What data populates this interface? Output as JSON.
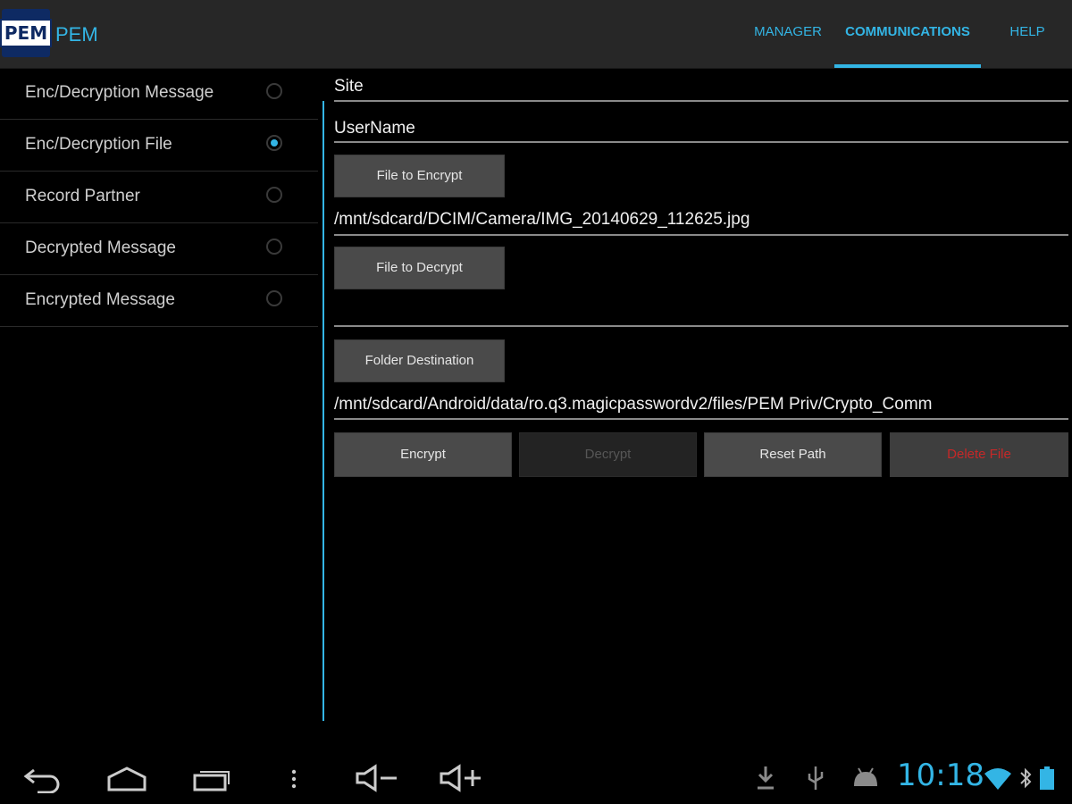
{
  "app": {
    "title": "PEM",
    "logo_text": "PEM"
  },
  "tabs": [
    {
      "label": "MANAGER",
      "active": false
    },
    {
      "label": "COMMUNICATIONS",
      "active": true
    },
    {
      "label": "HELP",
      "active": false
    }
  ],
  "sidebar": {
    "items": [
      {
        "label": "Enc/Decryption Message",
        "selected": false
      },
      {
        "label": "Enc/Decryption File",
        "selected": true
      },
      {
        "label": "Record Partner",
        "selected": false
      },
      {
        "label": "Decrypted Message",
        "selected": false
      },
      {
        "label": "Encrypted Message",
        "selected": false
      }
    ]
  },
  "form": {
    "site_label": "Site",
    "username_label": "UserName",
    "file_to_encrypt_button": "File to Encrypt",
    "encrypt_path": "/mnt/sdcard/DCIM/Camera/IMG_20140629_112625.jpg",
    "file_to_decrypt_button": "File to Decrypt",
    "decrypt_path": "",
    "folder_destination_button": "Folder Destination",
    "destination_path": "/mnt/sdcard/Android/data/ro.q3.magicpasswordv2/files/PEM Priv/Crypto_Comm"
  },
  "actions": {
    "encrypt": "Encrypt",
    "decrypt": "Decrypt",
    "reset_path": "Reset Path",
    "delete_file": "Delete File"
  },
  "status_bar": {
    "time": "10:18",
    "icons": [
      "download-icon",
      "usb-icon",
      "android-debug-icon",
      "wifi-icon",
      "bluetooth-icon",
      "battery-icon"
    ]
  },
  "nav_bar": {
    "icons": [
      "back-icon",
      "home-icon",
      "recent-apps-icon",
      "menu-icon",
      "volume-down-icon",
      "volume-up-icon"
    ]
  },
  "colors": {
    "accent": "#33b5e5",
    "danger": "#c62828",
    "action_bar": "#272727",
    "background": "#000000"
  }
}
